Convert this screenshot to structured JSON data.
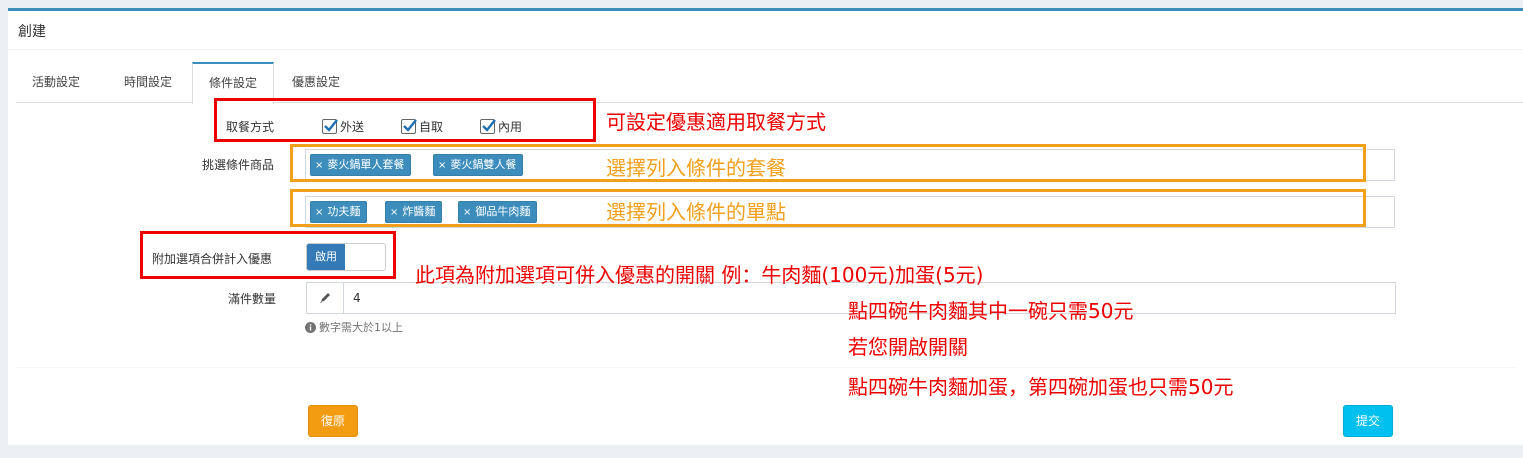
{
  "panel": {
    "title": "創建"
  },
  "tabs": [
    {
      "label": "活動設定"
    },
    {
      "label": "時間設定"
    },
    {
      "label": "條件設定"
    },
    {
      "label": "優惠設定"
    }
  ],
  "form": {
    "meal_method": {
      "label": "取餐方式",
      "options": [
        {
          "label": "外送",
          "checked": true
        },
        {
          "label": "自取",
          "checked": true
        },
        {
          "label": "內用",
          "checked": true
        }
      ]
    },
    "condition_products": {
      "label": "挑選條件商品",
      "set_tags": [
        "麥火鍋單人套餐",
        "麥火鍋雙人餐"
      ],
      "single_tags": [
        "功夫麵",
        "炸醬麵",
        "御品牛肉麵"
      ]
    },
    "addon_toggle": {
      "label": "附加選項合併計入優惠",
      "state": "啟用"
    },
    "quantity": {
      "label": "滿件數量",
      "value": "4",
      "help": "數字需大於1以上"
    }
  },
  "buttons": {
    "reset": "復原",
    "submit": "提交"
  },
  "annotations": {
    "meal_method_note": "可設定優惠適用取餐方式",
    "set_note": "選擇列入條件的套餐",
    "single_note": "選擇列入條件的單點",
    "toggle_note_1": "此項為附加選項可併入優惠的開關  例：牛肉麵(100元)加蛋(5元)",
    "toggle_note_2": "點四碗牛肉麵其中一碗只需50元",
    "toggle_note_3": "若您開啟開關",
    "toggle_note_4": "點四碗牛肉麵加蛋，第四碗加蛋也只需50元"
  },
  "colors": {
    "accent": "#3c8dbc",
    "annotation_red": "#ee0000",
    "annotation_orange": "#f2a01c",
    "reset": "#f39c12",
    "submit": "#00c0ef"
  }
}
